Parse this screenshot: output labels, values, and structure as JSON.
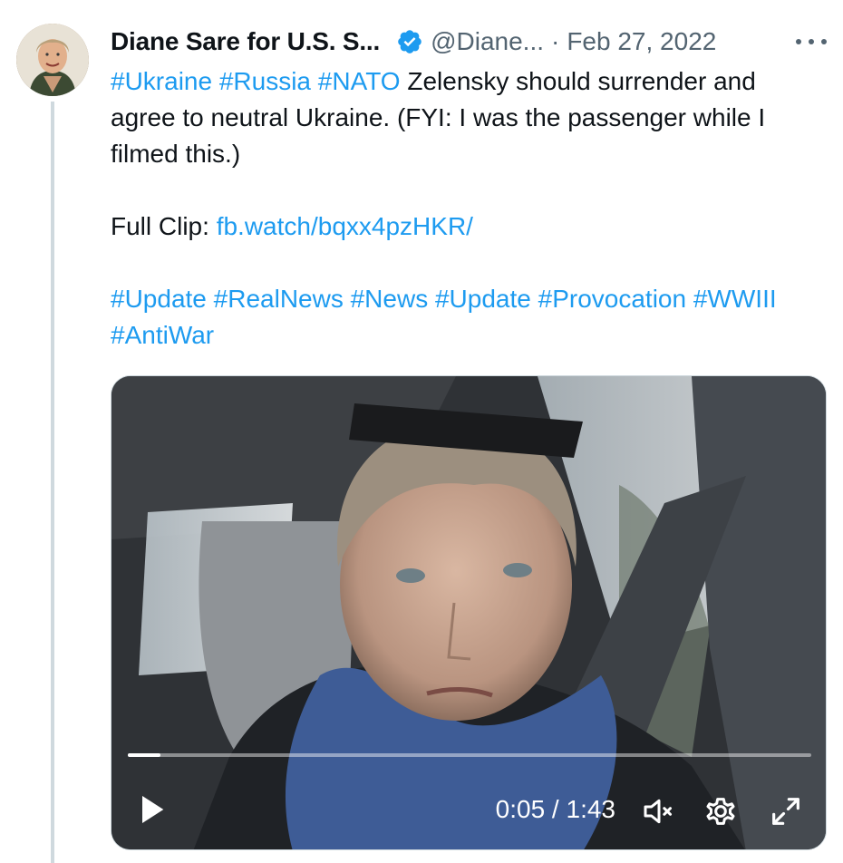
{
  "tweet": {
    "author_name": "Diane Sare for U.S. S...",
    "handle": "@Diane...",
    "separator": "·",
    "date": "Feb 27, 2022",
    "line1": [
      {
        "text": "#Ukraine",
        "type": "tag"
      },
      {
        "text": " ",
        "type": "text"
      },
      {
        "text": "#Russia",
        "type": "tag"
      },
      {
        "text": " ",
        "type": "text"
      },
      {
        "text": "#NATO",
        "type": "tag"
      },
      {
        "text": " Zelensky should surrender and agree to neutral Ukraine. (FYI: I was the passenger while I filmed this.)",
        "type": "text"
      }
    ],
    "full_clip_label": "Full Clip: ",
    "full_clip_link": "fb.watch/bqxx4pzHKR/",
    "hashtags_line": [
      {
        "text": "#Update",
        "type": "tag"
      },
      {
        "text": " ",
        "type": "text"
      },
      {
        "text": "#RealNews",
        "type": "tag"
      },
      {
        "text": " ",
        "type": "text"
      },
      {
        "text": "#News",
        "type": "tag"
      },
      {
        "text": " ",
        "type": "text"
      },
      {
        "text": "#Update",
        "type": "tag"
      },
      {
        "text": " ",
        "type": "text"
      },
      {
        "text": "#Provocation",
        "type": "tag"
      },
      {
        "text": " ",
        "type": "text"
      },
      {
        "text": "#WWIII",
        "type": "tag"
      },
      {
        "text": " ",
        "type": "text"
      },
      {
        "text": "#AntiWar",
        "type": "tag"
      }
    ]
  },
  "video": {
    "time_display": "0:05 / 1:43",
    "progress_fraction": 0.048
  },
  "icons": {
    "verified": "verified-badge-icon",
    "more": "more-options-icon",
    "play": "play-icon",
    "mute": "volume-muted-icon",
    "settings": "gear-icon",
    "fullscreen": "fullscreen-icon"
  },
  "colors": {
    "link": "#1d9bf0",
    "secondary_text": "#536471",
    "primary_text": "#0f1419",
    "verified": "#1d9bf0",
    "thread_line": "#cfd9de"
  }
}
